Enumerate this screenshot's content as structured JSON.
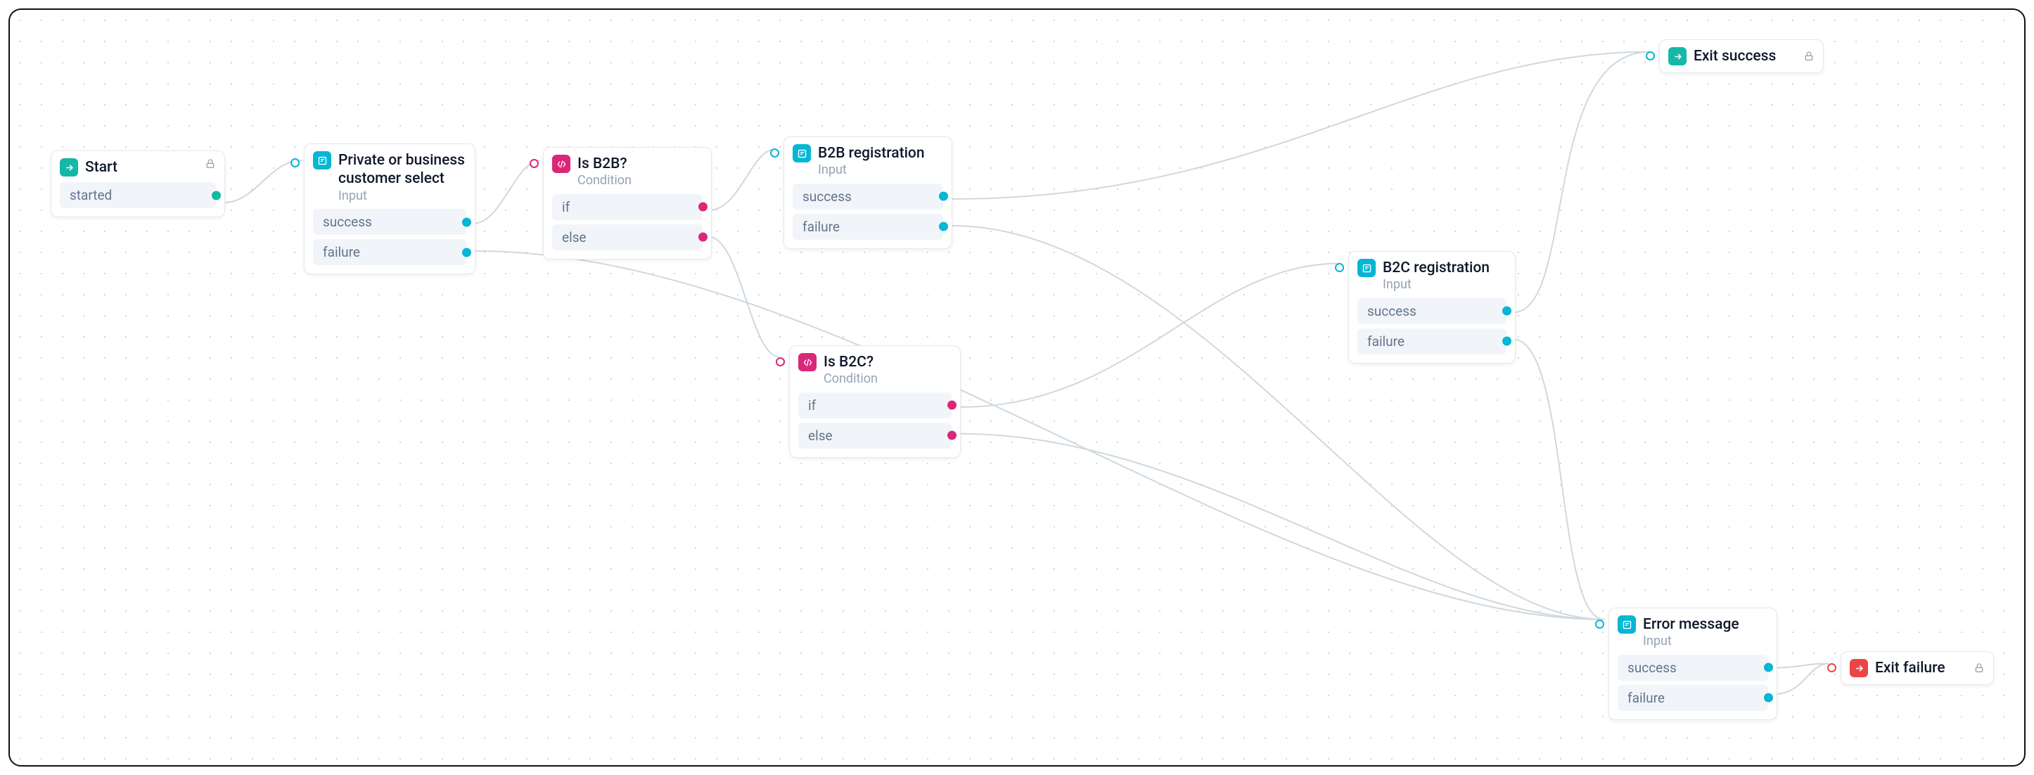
{
  "nodes": {
    "start": {
      "title": "Start",
      "outputs": [
        "started"
      ]
    },
    "select": {
      "title": "Private or business customer select",
      "subtitle": "Input",
      "outputs": [
        "success",
        "failure"
      ]
    },
    "isB2B": {
      "title": "Is B2B?",
      "subtitle": "Condition",
      "outputs": [
        "if",
        "else"
      ]
    },
    "b2bReg": {
      "title": "B2B registration",
      "subtitle": "Input",
      "outputs": [
        "success",
        "failure"
      ]
    },
    "isB2C": {
      "title": "Is B2C?",
      "subtitle": "Condition",
      "outputs": [
        "if",
        "else"
      ]
    },
    "b2cReg": {
      "title": "B2C registration",
      "subtitle": "Input",
      "outputs": [
        "success",
        "failure"
      ]
    },
    "error": {
      "title": "Error message",
      "subtitle": "Input",
      "outputs": [
        "success",
        "failure"
      ]
    },
    "exitSuccess": {
      "title": "Exit success"
    },
    "exitFailure": {
      "title": "Exit failure"
    }
  },
  "colors": {
    "teal": "#14b8a6",
    "cyan": "#06b6d4",
    "magenta": "#db2777",
    "red": "#ef4444",
    "edge": "#cfd8df"
  }
}
